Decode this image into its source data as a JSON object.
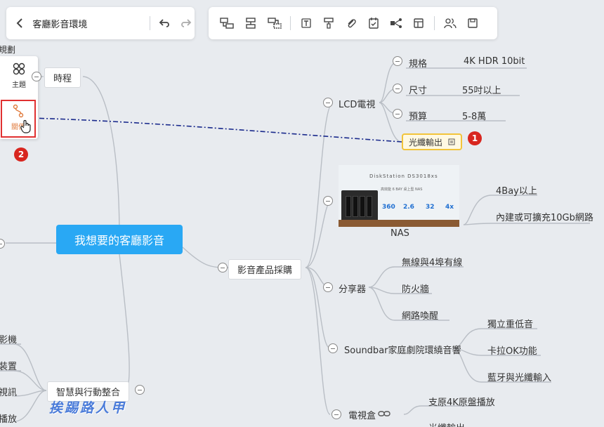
{
  "app": {
    "doc_title": "客廳影音環境"
  },
  "side_panel": {
    "theme_label": "主題",
    "relation_label": "關係",
    "top_clip": "規劃"
  },
  "badges": [
    "1",
    "2"
  ],
  "mindmap": {
    "root": "我想要的客廳影音",
    "branches": {
      "timeline": "時程",
      "purchase": "影音產品採購",
      "smart": "智慧與行動整合"
    },
    "lcd": {
      "label": "LCD電視",
      "specs": [
        {
          "key": "規格",
          "value": "4K HDR 10bit"
        },
        {
          "key": "尺寸",
          "value": "55吋以上"
        },
        {
          "key": "預算",
          "value": "5-8萬"
        }
      ],
      "optical": "光纖輸出"
    },
    "nas": {
      "label": "NAS",
      "image_title": "DiskStation DS3018xs",
      "image_sub": "高效能 6 BAY 桌上型 NAS",
      "stats": [
        "360",
        "2.6",
        "32",
        "4x"
      ],
      "children": [
        "4Bay以上",
        "內建或可擴充10Gb網路"
      ]
    },
    "router": {
      "label": "分享器",
      "children": [
        "無線與4埠有線",
        "防火牆",
        "網路喚醒"
      ]
    },
    "soundbar": {
      "label": "Soundbar家庭劇院環繞音響",
      "children": [
        "獨立重低音",
        "卡拉OK功能",
        "藍牙與光纖輸入"
      ]
    },
    "tvbox": {
      "label": "電視盒",
      "children": [
        "支原4K原盤播放",
        "光纖輸出"
      ]
    },
    "left_clipped": [
      "影機",
      "裝置",
      "視訊",
      "播放"
    ]
  },
  "watermark": "挨踢路人甲",
  "colors": {
    "root": "#29a8f4",
    "relation": "#1a2a8c",
    "badge": "#d8261f",
    "highlight": "#f2c43a"
  }
}
